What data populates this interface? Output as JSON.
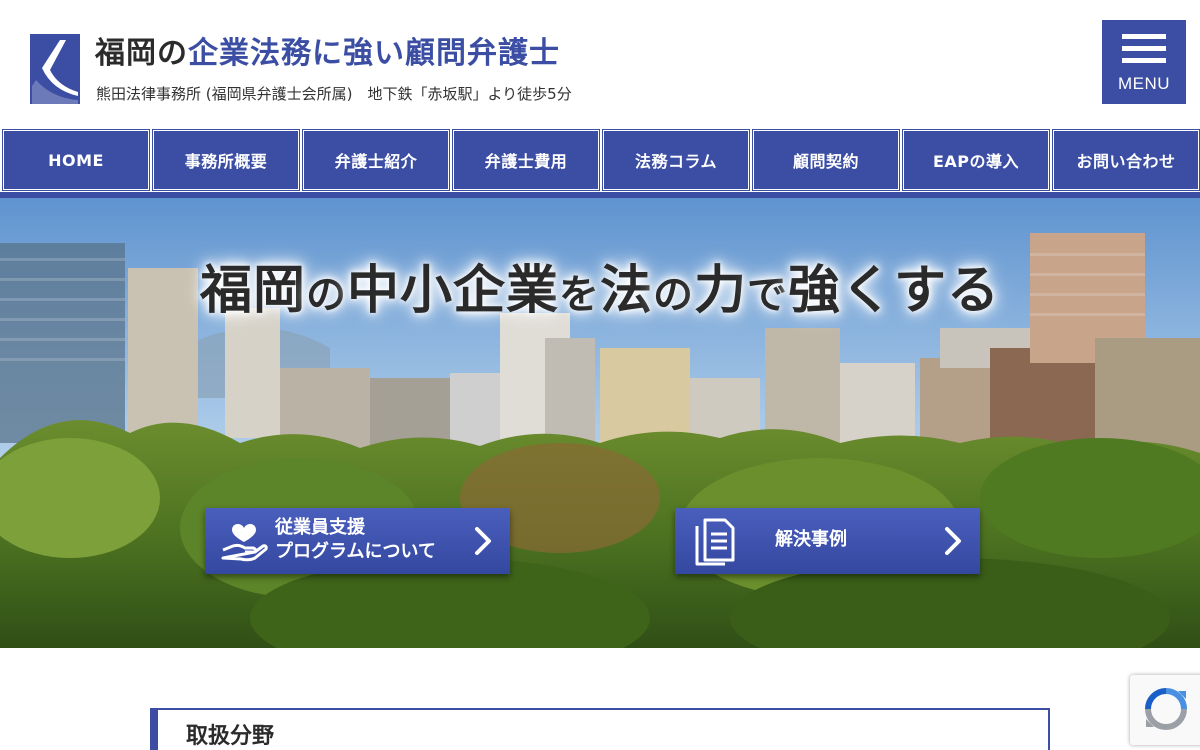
{
  "header": {
    "logo_icon": "law-firm-logo-icon",
    "title_part1": "福岡の",
    "title_part2": "企業法務に強い顧問弁護士",
    "subtitle": "熊田法律事務所 (福岡県弁護士会所属)　地下鉄「赤坂駅」より徒歩5分",
    "menu_label": "MENU",
    "menu_icon": "hamburger-icon"
  },
  "nav": {
    "items": [
      {
        "label": "HOME"
      },
      {
        "label": "事務所概要"
      },
      {
        "label": "弁護士紹介"
      },
      {
        "label": "弁護士費用"
      },
      {
        "label": "法務コラム"
      },
      {
        "label": "顧問契約"
      },
      {
        "label": "EAPの導入"
      },
      {
        "label": "お問い合わせ"
      }
    ]
  },
  "hero": {
    "headline": {
      "p1": "福岡",
      "p2": "の",
      "p3": "中小企業",
      "p4": "を",
      "p5": "法",
      "p6": "の",
      "p7": "力",
      "p8": "で",
      "p9": "強くする"
    },
    "buttons": [
      {
        "line1": "従業員支援",
        "line2": "プログラムについて",
        "icon": "heart-hand-icon"
      },
      {
        "label": "解決事例",
        "icon": "document-icon"
      }
    ]
  },
  "section": {
    "title": "取扱分野"
  },
  "colors": {
    "primary": "#3b4ea3",
    "text_dark": "#2b2b2b",
    "white": "#ffffff"
  }
}
